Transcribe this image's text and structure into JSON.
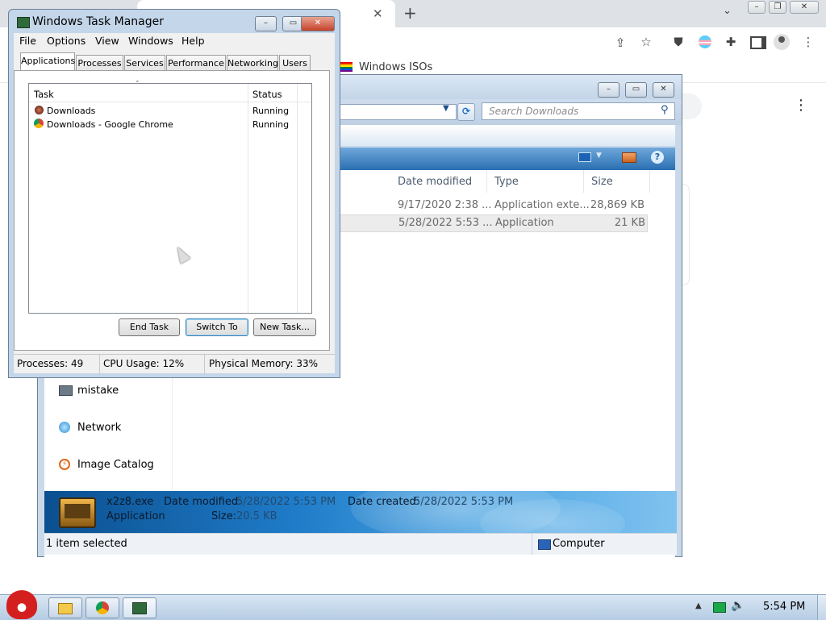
{
  "browser": {
    "bookmark_label": "Windows ISOs"
  },
  "explorer": {
    "search_placeholder": "Search Downloads",
    "columns": {
      "date": "Date modified",
      "type": "Type",
      "size": "Size"
    },
    "rows": [
      {
        "date": "9/17/2020 2:38 ...",
        "type": "Application exte...",
        "size": "28,869 KB"
      },
      {
        "date": "5/28/2022 5:53 ...",
        "type": "Application",
        "size": "21 KB"
      }
    ],
    "nav_items": [
      {
        "label": "mistake",
        "icon": "network-folder-icon"
      },
      {
        "label": "Network",
        "icon": "network-icon"
      },
      {
        "label": "Image Catalog",
        "icon": "image-catalog-icon"
      }
    ],
    "details": {
      "filename": "x2z8.exe",
      "filetype": "Application",
      "date_modified_label": "Date modified:",
      "date_modified_value": "5/28/2022 5:53 PM",
      "size_label": "Size:",
      "size_value": "20.5 KB",
      "date_created_label": "Date created:",
      "date_created_value": "5/28/2022 5:53 PM"
    },
    "status_left": "1 item selected",
    "status_right": "Computer"
  },
  "task_manager": {
    "title": "Windows Task Manager",
    "menu": [
      "File",
      "Options",
      "View",
      "Windows",
      "Help"
    ],
    "tabs": [
      "Applications",
      "Processes",
      "Services",
      "Performance",
      "Networking",
      "Users"
    ],
    "columns": {
      "task": "Task",
      "status": "Status"
    },
    "tasks": [
      {
        "task": "Downloads",
        "status": "Running"
      },
      {
        "task": "Downloads - Google Chrome",
        "status": "Running"
      }
    ],
    "buttons": {
      "end_task": "End Task",
      "switch_to": "Switch To",
      "new_task": "New Task..."
    },
    "status": {
      "processes": "Processes: 49",
      "cpu": "CPU Usage: 12%",
      "memory": "Physical Memory: 33%"
    }
  },
  "taskbar": {
    "clock": "5:54 PM"
  }
}
